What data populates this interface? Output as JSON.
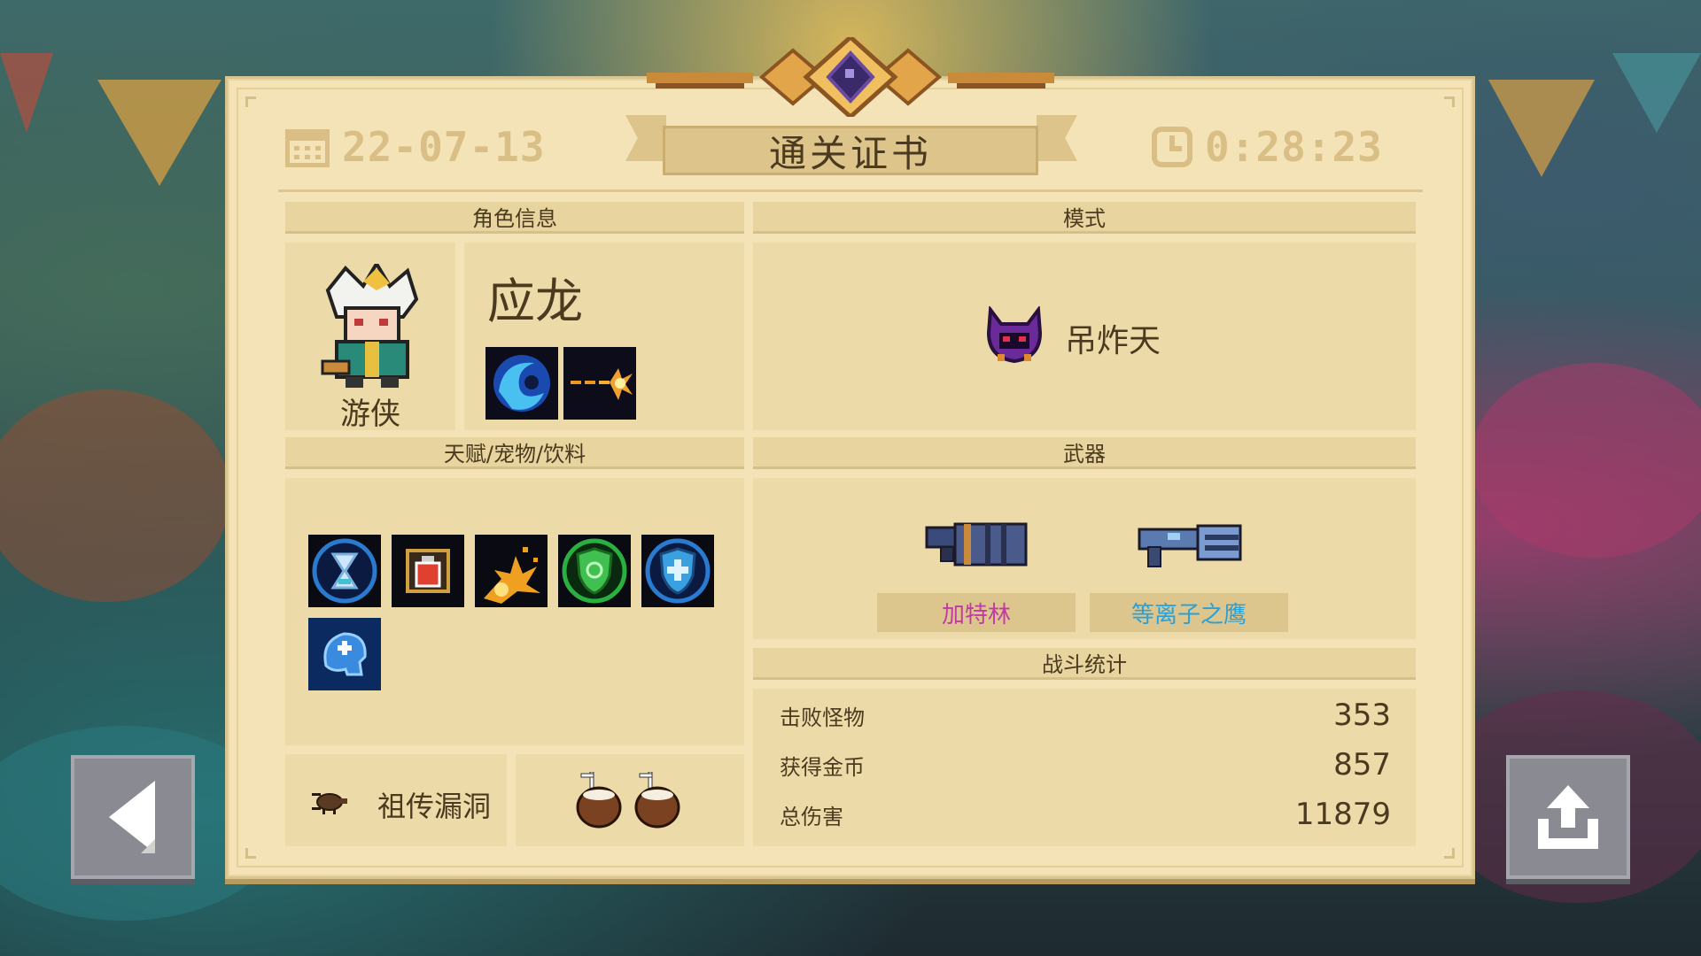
{
  "certificate": {
    "date": "22-07-13",
    "title": "通关证书",
    "time": "0:28:23",
    "date_icon": "calendar-icon",
    "time_icon": "clock-icon"
  },
  "sections": {
    "character_info": "角色信息",
    "mode": "模式",
    "talents": "天赋/宠物/饮料",
    "weapons": "武器",
    "battle_stats": "战斗统计"
  },
  "character": {
    "name": "应龙",
    "class": "游侠",
    "portrait_icon": "ranger-hero-icon",
    "skills": [
      {
        "icon": "water-vortex-skill-icon"
      },
      {
        "icon": "fire-dash-skill-icon"
      }
    ]
  },
  "mode": {
    "name": "吊炸天",
    "icon": "purple-demon-helmet-icon"
  },
  "talents": [
    {
      "icon": "hourglass-talent-icon"
    },
    {
      "icon": "potion-bottle-talent-icon"
    },
    {
      "icon": "fire-burst-talent-icon"
    },
    {
      "icon": "green-shield-talent-icon"
    },
    {
      "icon": "blue-shield-talent-icon"
    },
    {
      "icon": "brain-talent-icon"
    }
  ],
  "pet": {
    "name": "祖传漏洞",
    "icon": "bug-pet-icon"
  },
  "drinks": [
    {
      "icon": "coconut-drink-icon"
    },
    {
      "icon": "coconut-drink-icon"
    }
  ],
  "weapons": [
    {
      "name": "加特林",
      "color": "#c23aa5",
      "icon": "gatling-gun-icon"
    },
    {
      "name": "等离子之鹰",
      "color": "#2aa0d6",
      "icon": "plasma-eagle-gun-icon"
    }
  ],
  "stats": [
    {
      "label": "击败怪物",
      "value": "353"
    },
    {
      "label": "获得金币",
      "value": "857"
    },
    {
      "label": "总伤害",
      "value": "11879"
    }
  ],
  "colors": {
    "card": "#f3e3b6",
    "section_header": "#e7d49f",
    "text": "#4b3a1f",
    "accent_gold": "#d9bf85"
  },
  "buttons": {
    "back_icon": "back-arrow-icon",
    "share_icon": "share-upload-icon"
  }
}
